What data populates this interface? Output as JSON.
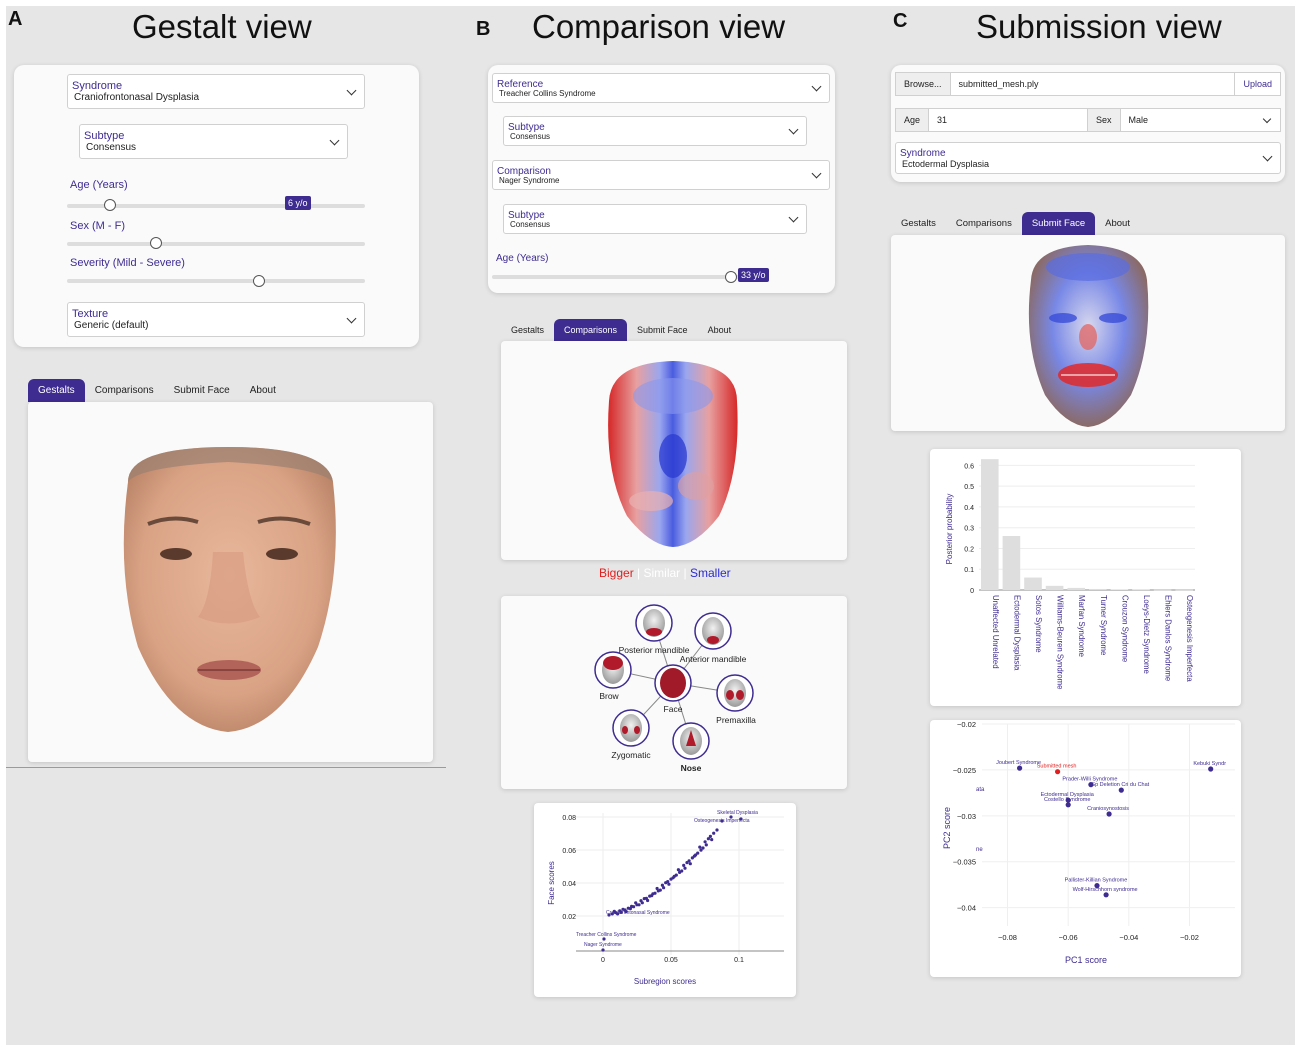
{
  "panels": {
    "a": {
      "letter": "A",
      "title": "Gestalt view"
    },
    "b": {
      "letter": "B",
      "title": "Comparison view"
    },
    "c": {
      "letter": "C",
      "title": "Submission view"
    }
  },
  "gestalt": {
    "syndrome": {
      "label": "Syndrome",
      "value": "Craniofrontonasal Dysplasia"
    },
    "subtype": {
      "label": "Subtype",
      "value": "Consensus"
    },
    "age": {
      "label": "Age (Years)",
      "badge": "6 y/o",
      "level": 0.15
    },
    "sex": {
      "label": "Sex (M - F)",
      "level": 0.3
    },
    "severity": {
      "label": "Severity (Mild - Severe)",
      "level": 0.65
    },
    "texture": {
      "label": "Texture",
      "value": "Generic (default)"
    },
    "tabs": [
      "Gestalts",
      "Comparisons",
      "Submit Face",
      "About"
    ],
    "active_tab": "Gestalts"
  },
  "comparison": {
    "reference": {
      "label": "Reference",
      "value": "Treacher Collins Syndrome"
    },
    "ref_subtype": {
      "label": "Subtype",
      "value": "Consensus"
    },
    "comparison": {
      "label": "Comparison",
      "value": "Nager Syndrome"
    },
    "cmp_subtype": {
      "label": "Subtype",
      "value": "Consensus"
    },
    "age": {
      "label": "Age (Years)",
      "badge": "33 y/o",
      "level": 0.95
    },
    "tabs": [
      "Gestalts",
      "Comparisons",
      "Submit Face",
      "About"
    ],
    "active_tab": "Comparisons",
    "legend": {
      "bigger": "Bigger",
      "sep1": "|",
      "similar": "Similar",
      "sep2": "|",
      "smaller": "Smaller"
    },
    "network": {
      "nodes": [
        "Posterior mandible",
        "Anterior mandible",
        "Brow",
        "Face",
        "Premaxilla",
        "Zygomatic",
        "Nose"
      ]
    },
    "scatter": {
      "xlabel": "Subregion scores",
      "ylabel": "Face scores",
      "x_ticks": [
        "0",
        "0.05",
        "0.1"
      ],
      "y_ticks": [
        "0.02",
        "0.04",
        "0.06",
        "0.08"
      ],
      "annotations": [
        "Skeletal Dysplasia",
        "Osteogenesis Imperfecta",
        "Craniofrontonasal Syndrome",
        "Treacher Collins Syndrome",
        "Nager Syndrome"
      ]
    }
  },
  "submission": {
    "browse": "Browse...",
    "file": "submitted_mesh.ply",
    "upload": "Upload",
    "age_label": "Age",
    "age_value": "31",
    "sex_label": "Sex",
    "sex_value": "Male",
    "syndrome": {
      "label": "Syndrome",
      "value": "Ectodermal Dysplasia"
    },
    "tabs": [
      "Gestalts",
      "Comparisons",
      "Submit Face",
      "About"
    ],
    "active_tab": "Submit Face",
    "bar_ylabel": "Posterior probability",
    "pca": {
      "xlabel": "PC1 score",
      "ylabel": "PC2 score",
      "x_ticks": [
        "−0.08",
        "−0.06",
        "−0.04",
        "−0.02"
      ],
      "y_ticks": [
        "−0.02",
        "−0.025",
        "−0.03",
        "−0.035",
        "−0.04"
      ],
      "edge_labels": [
        "ata",
        "ne"
      ]
    }
  },
  "colors": {
    "accent": "#3f2c91",
    "bigger": "#e02020",
    "smaller": "#2a2ad6",
    "similar": "#ffffff",
    "submitted": "#e02020"
  },
  "chart_data": [
    {
      "type": "bar",
      "title": "",
      "xlabel": "",
      "ylabel": "Posterior probability",
      "ylim": [
        0,
        0.65
      ],
      "y_ticks": [
        "0",
        "0.1",
        "0.2",
        "0.3",
        "0.4",
        "0.5",
        "0.6"
      ],
      "categories": [
        "Unaffected Unrelated",
        "Ectodermal Dysplasia",
        "Sotos Syndrome",
        "Williams-Beuren Syndrome",
        "Marfan Syndrome",
        "Turner Syndrome",
        "Crouzon Syndrome",
        "Loeys-Dietz Syndrome",
        "Ehlers Danlos Syndrome",
        "Osteogenesis Imperfecta"
      ],
      "values": [
        0.63,
        0.26,
        0.06,
        0.02,
        0.01,
        0.005,
        0.003,
        0.002,
        0.001,
        0.001
      ]
    },
    {
      "type": "scatter",
      "xlabel": "PC1 score",
      "ylabel": "PC2 score",
      "xlim": [
        -0.095,
        -0.005
      ],
      "ylim": [
        -0.042,
        -0.02
      ],
      "points": [
        {
          "label": "Joubert Syndrome",
          "x": -0.076,
          "y": -0.0248,
          "highlight": false
        },
        {
          "label": "Submitted mesh",
          "x": -0.0635,
          "y": -0.0252,
          "highlight": true
        },
        {
          "label": "Kebuki Syndr",
          "x": -0.013,
          "y": -0.0249,
          "highlight": false
        },
        {
          "label": "Prader-Willi Syndrome",
          "x": -0.0525,
          "y": -0.0266,
          "highlight": false
        },
        {
          "label": "Sp Deletion Cri du Chat",
          "x": -0.0425,
          "y": -0.0272,
          "highlight": false
        },
        {
          "label": "Ectodermal Dysplasia",
          "x": -0.06,
          "y": -0.0283,
          "highlight": false
        },
        {
          "label": "Costello Syndrome",
          "x": -0.06,
          "y": -0.0288,
          "highlight": false
        },
        {
          "label": "Craniosynostosis",
          "x": -0.0465,
          "y": -0.0298,
          "highlight": false
        },
        {
          "label": "Pallister-Killian Syndrome",
          "x": -0.0505,
          "y": -0.0376,
          "highlight": false
        },
        {
          "label": "Wolf-Hirschhorn syndrome",
          "x": -0.0475,
          "y": -0.0386,
          "highlight": false
        }
      ]
    }
  ]
}
